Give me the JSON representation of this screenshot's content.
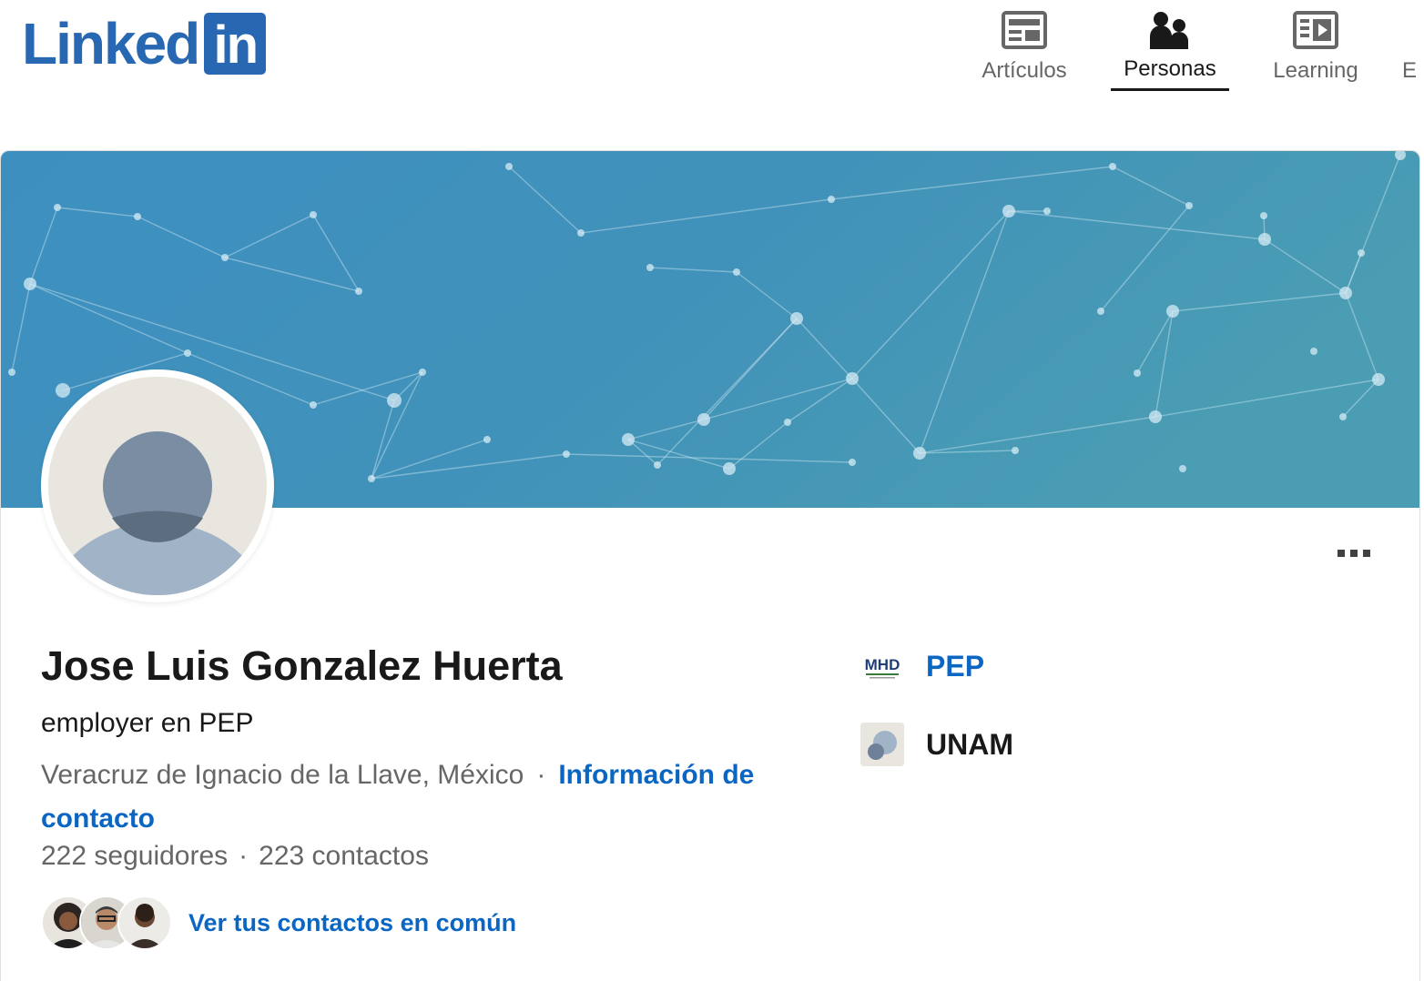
{
  "header": {
    "logo_text": "Linked",
    "logo_box_text": "in",
    "nav": [
      {
        "label": "Artículos",
        "icon": "articles-icon",
        "active": false
      },
      {
        "label": "Personas",
        "icon": "people-icon",
        "active": true
      },
      {
        "label": "Learning",
        "icon": "learning-icon",
        "active": false
      },
      {
        "label": "E",
        "icon": "",
        "active": false
      }
    ]
  },
  "profile": {
    "name": "Jose Luis Gonzalez Huerta",
    "headline": "employer en PEP",
    "location": "Veracruz de Ignacio de la Llave, México",
    "separator": "·",
    "contact_info_link": "Información de contacto",
    "followers": "222 seguidores",
    "connections": "223 contactos",
    "mutual_connections_link": "Ver tus contactos en común"
  },
  "companies": [
    {
      "name": "PEP",
      "logo_text": "MHD",
      "is_link": true
    },
    {
      "name": "UNAM",
      "logo_text": "",
      "is_link": false
    }
  ],
  "colors": {
    "brand_blue": "#0a66c2",
    "logo_blue": "#2867b2",
    "banner_start": "#3b8fbf",
    "banner_end": "#4a9fb0",
    "text_primary": "#191919",
    "text_secondary": "#666666"
  }
}
